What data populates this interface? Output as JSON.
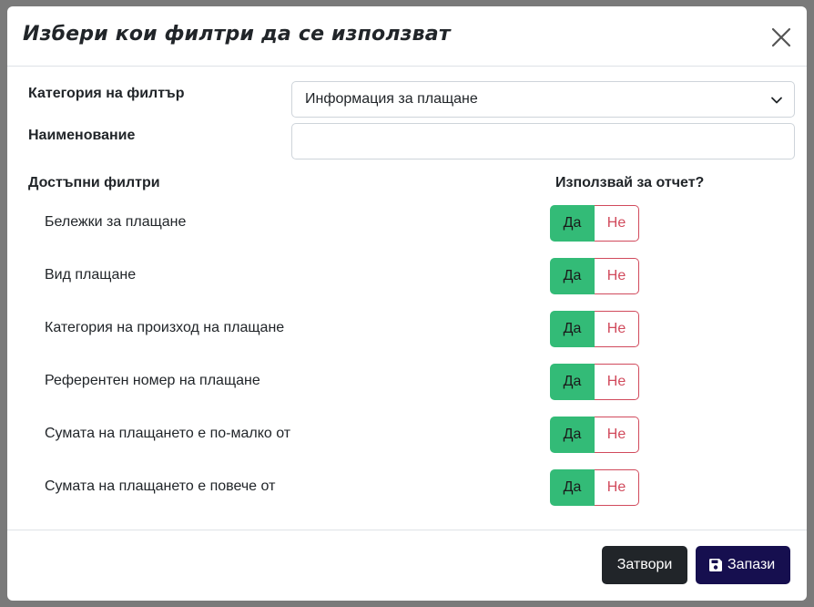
{
  "modal": {
    "title": "Избери кои филтри да се използват"
  },
  "form": {
    "category_label": "Категория на филтър",
    "category_value": "Информация за плащане",
    "name_label": "Наименование",
    "name_value": "",
    "available_filters_label": "Достъпни филтри",
    "use_for_report_label": "Използвай за отчет?"
  },
  "filters": [
    {
      "label": "Бележки за плащане",
      "yes": "Да",
      "no": "Не"
    },
    {
      "label": "Вид плащане",
      "yes": "Да",
      "no": "Не"
    },
    {
      "label": "Категория на произход на плащане",
      "yes": "Да",
      "no": "Не"
    },
    {
      "label": "Референтен номер на плащане",
      "yes": "Да",
      "no": "Не"
    },
    {
      "label": "Сумата на плащането е по-малко от",
      "yes": "Да",
      "no": "Не"
    },
    {
      "label": "Сумата на плащането е повече от",
      "yes": "Да",
      "no": "Не"
    }
  ],
  "footer": {
    "close_label": "Затвори",
    "save_label": "Запази"
  },
  "colors": {
    "yes_active": "#33bb77",
    "no_border": "#d14a5c",
    "close_button": "#212529",
    "save_button": "#160f4f"
  }
}
